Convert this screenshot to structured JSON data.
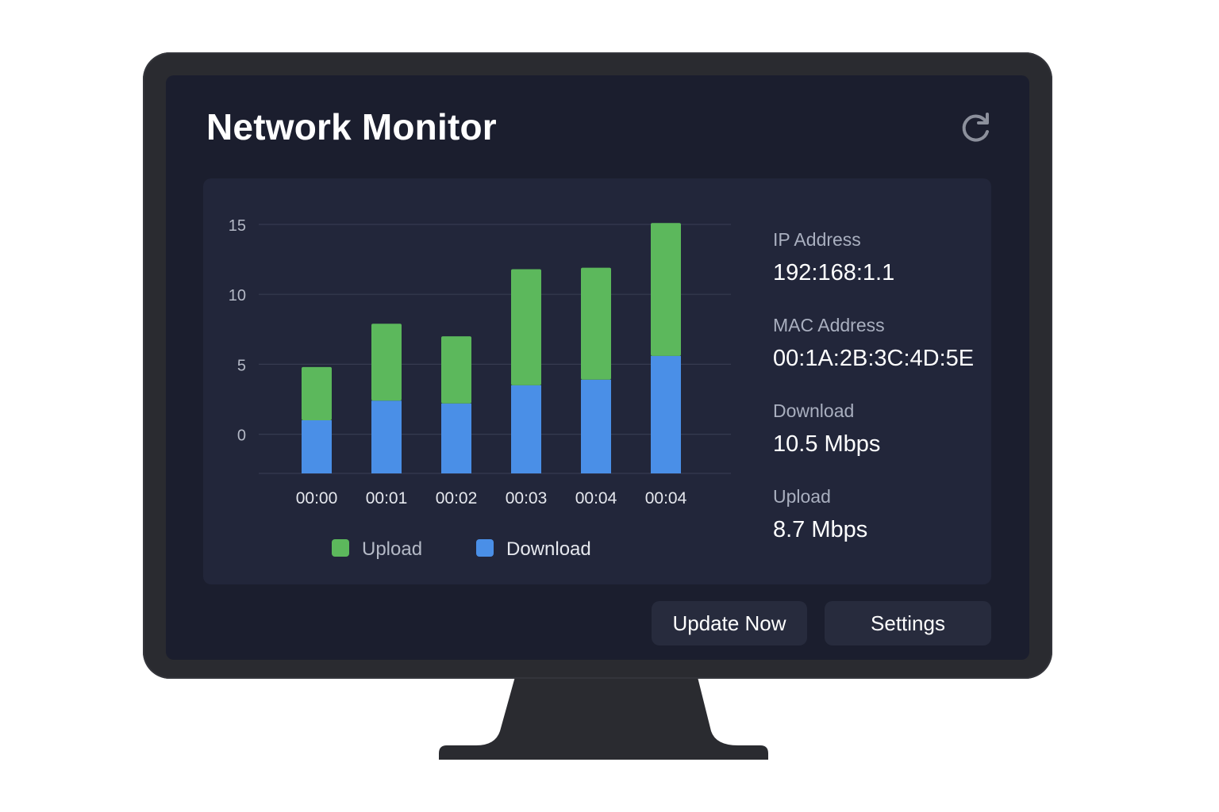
{
  "app": {
    "title": "Network Monitor"
  },
  "icons": {
    "refresh": "refresh-icon"
  },
  "info": {
    "items": [
      {
        "label": "IP Address",
        "value": "192:168:1.1"
      },
      {
        "label": "MAC Address",
        "value": "00:1A:2B:3C:4D:5E"
      },
      {
        "label": "Download",
        "value": "10.5 Mbps"
      },
      {
        "label": "Upload",
        "value": "8.7 Mbps"
      }
    ]
  },
  "actions": {
    "update_label": "Update Now",
    "settings_label": "Settings"
  },
  "colors": {
    "upload": "#5cb85c",
    "download": "#4a8fe7",
    "screen": "#1b1e2e",
    "panel": "#22263a"
  },
  "chart_data": {
    "type": "bar",
    "stacked": true,
    "categories": [
      "00:00",
      "00:01",
      "00:02",
      "00:03",
      "00:04",
      "00:04"
    ],
    "series": [
      {
        "name": "Download",
        "values": [
          1.0,
          2.4,
          2.2,
          3.5,
          3.9,
          5.6
        ]
      },
      {
        "name": "Upload",
        "values": [
          3.8,
          5.5,
          4.8,
          8.3,
          8.0,
          9.5
        ]
      }
    ],
    "yticks": [
      0,
      5,
      10,
      15
    ],
    "ylim": [
      -2.8,
      15
    ],
    "grid": true,
    "legend": {
      "position": "bottom",
      "entries": [
        "Upload",
        "Download"
      ]
    }
  }
}
